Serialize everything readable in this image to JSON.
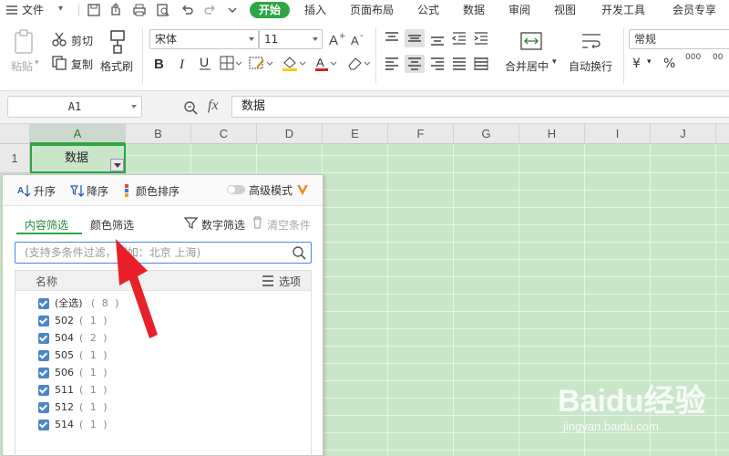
{
  "menubar": {
    "file_label": "文件",
    "tabs": [
      {
        "label": "开始",
        "active": true
      },
      {
        "label": "插入"
      },
      {
        "label": "页面布局"
      },
      {
        "label": "公式"
      },
      {
        "label": "数据"
      },
      {
        "label": "审阅"
      },
      {
        "label": "视图"
      },
      {
        "label": "开发工具"
      },
      {
        "label": "会员专享"
      }
    ]
  },
  "ribbon": {
    "paste_label": "粘贴",
    "cut_label": "剪切",
    "copy_label": "复制",
    "format_painter_label": "格式刷",
    "font_name": "宋体",
    "font_size": "11",
    "merge_label": "合并居中",
    "wrap_label": "自动换行",
    "number_format": "常规",
    "currency_symbol": "¥",
    "percent_symbol": "%",
    "dec_inc": "000",
    "dec_dec": "00"
  },
  "formula_bar": {
    "name_box": "A1",
    "fx_label": "fx",
    "value": "数据"
  },
  "sheet": {
    "columns": [
      "A",
      "B",
      "C",
      "D",
      "E",
      "F",
      "G",
      "H",
      "I",
      "J"
    ],
    "row_1": "1",
    "cell_a1": "数据"
  },
  "filter_panel": {
    "sort_asc": "升序",
    "sort_desc": "降序",
    "color_sort": "颜色排序",
    "advanced_mode": "高级模式",
    "tabs": {
      "content": "内容筛选",
      "color": "颜色筛选",
      "number": "数字筛选",
      "clear": "清空条件"
    },
    "search_placeholder": "(支持多条件过滤，例如：北京 上海)",
    "list_header": "名称",
    "options_label": "选项",
    "items": [
      {
        "label": "(全选)",
        "count": "( 8 )"
      },
      {
        "label": "502",
        "count": "( 1 )"
      },
      {
        "label": "504",
        "count": "( 2 )"
      },
      {
        "label": "505",
        "count": "( 1 )"
      },
      {
        "label": "506",
        "count": "( 1 )"
      },
      {
        "label": "511",
        "count": "( 1 )"
      },
      {
        "label": "512",
        "count": "( 1 )"
      },
      {
        "label": "514",
        "count": "( 1 )"
      }
    ]
  },
  "watermark": {
    "brand": "Baidu经验",
    "url": "jingyan.baidu.com"
  },
  "colors": {
    "accent_green": "#2ea644",
    "sheet_bg": "#c9e6c9",
    "checkbox_blue": "#4a86c8",
    "arrow_red": "#e8202a"
  }
}
